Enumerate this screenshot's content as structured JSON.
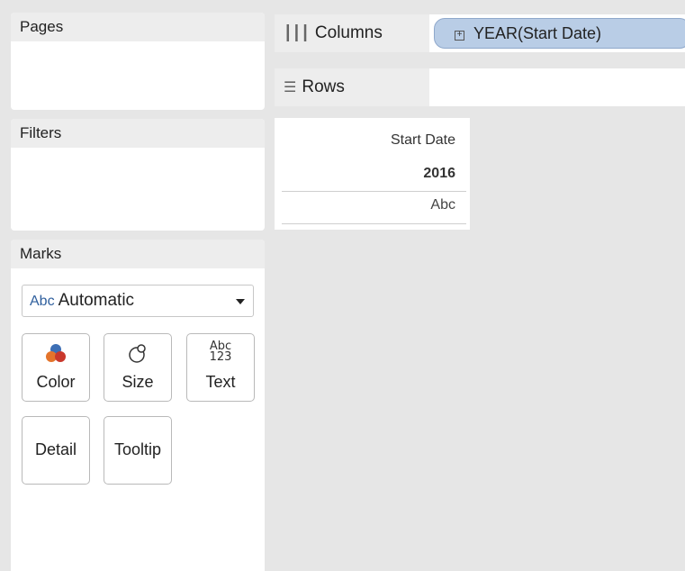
{
  "panels": {
    "pages": {
      "title": "Pages"
    },
    "filters": {
      "title": "Filters"
    },
    "marks": {
      "title": "Marks",
      "mark_type": {
        "icon_text": "Abc",
        "value": "Automatic"
      },
      "buttons": {
        "color": "Color",
        "size": "Size",
        "text": "Text",
        "text_icon_top": "Abc",
        "text_icon_bottom": "123",
        "detail": "Detail",
        "tooltip": "Tooltip"
      }
    }
  },
  "shelves": {
    "columns": {
      "label": "Columns",
      "pill": "YEAR(Start Date)",
      "pill_toggle": "+"
    },
    "rows": {
      "label": "Rows"
    }
  },
  "view": {
    "header": "Start Date",
    "year": "2016",
    "cell": "Abc"
  },
  "colors": {
    "pill_bg": "#b9cde6",
    "color_icon_blue": "#3d6fb5",
    "color_icon_orange": "#e4742b",
    "color_icon_red": "#c9382c"
  }
}
